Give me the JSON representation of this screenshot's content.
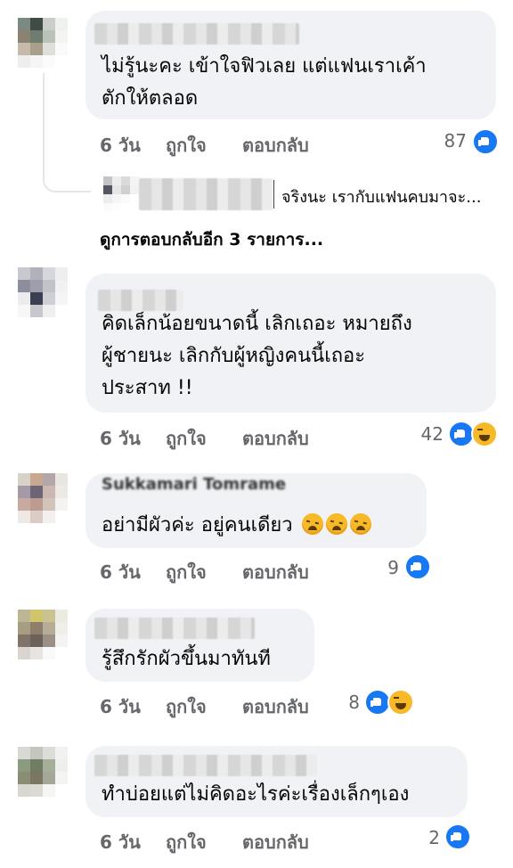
{
  "comments": [
    {
      "text_lines": [
        "ไม่รู้นะคะ เข้าใจฟิวเลย แต่แฟนเราเค้า",
        "ตักให้ตลอด"
      ],
      "time": "6 วัน",
      "like": "ถูกใจ",
      "reply": "ตอบกลับ",
      "count": "87",
      "reactions": [
        "like"
      ]
    },
    {
      "text_lines": [
        "คิดเล็กน้อยขนาดนี้ เลิกเถอะ หมายถึง",
        "ผู้ชายนะ เลิกกับผู้หญิงคนนี้เถอะ",
        "ประสาท !!"
      ],
      "time": "6 วัน",
      "like": "ถูกใจ",
      "reply": "ตอบกลับ",
      "count": "42",
      "reactions": [
        "like",
        "haha"
      ]
    },
    {
      "name_partial": "Sukkamari Tomrame",
      "text_lines": [
        "อย่ามีผัวค่ะ อยู่คนเดียว"
      ],
      "emoji": "😩😩😩",
      "time": "6 วัน",
      "like": "ถูกใจ",
      "reply": "ตอบกลับ",
      "count": "9",
      "reactions": [
        "like"
      ]
    },
    {
      "text_lines": [
        "รู้สึกรักผัวขึ้นมาทันที"
      ],
      "time": "6 วัน",
      "like": "ถูกใจ",
      "reply": "ตอบกลับ",
      "count": "8",
      "reactions": [
        "like",
        "haha"
      ]
    },
    {
      "text_lines": [
        "ทำบ่อยแต่ไม่คิดอะไรค่ะเรื่องเล็กๆเอง"
      ],
      "time": "6 วัน",
      "like": "ถูกใจ",
      "reply": "ตอบกลับ",
      "count": "2",
      "reactions": [
        "like"
      ]
    }
  ],
  "reply_preview": {
    "text": "จริงนะ เรากับแฟนคบมาจะ..."
  },
  "more_replies": "ดูการตอบกลับอีก 3 รายการ...",
  "colors": {
    "bubble": "#f0f2f5",
    "meta": "#65676b",
    "like_blue": "#1877f2",
    "haha_yellow": "#f7b928"
  }
}
